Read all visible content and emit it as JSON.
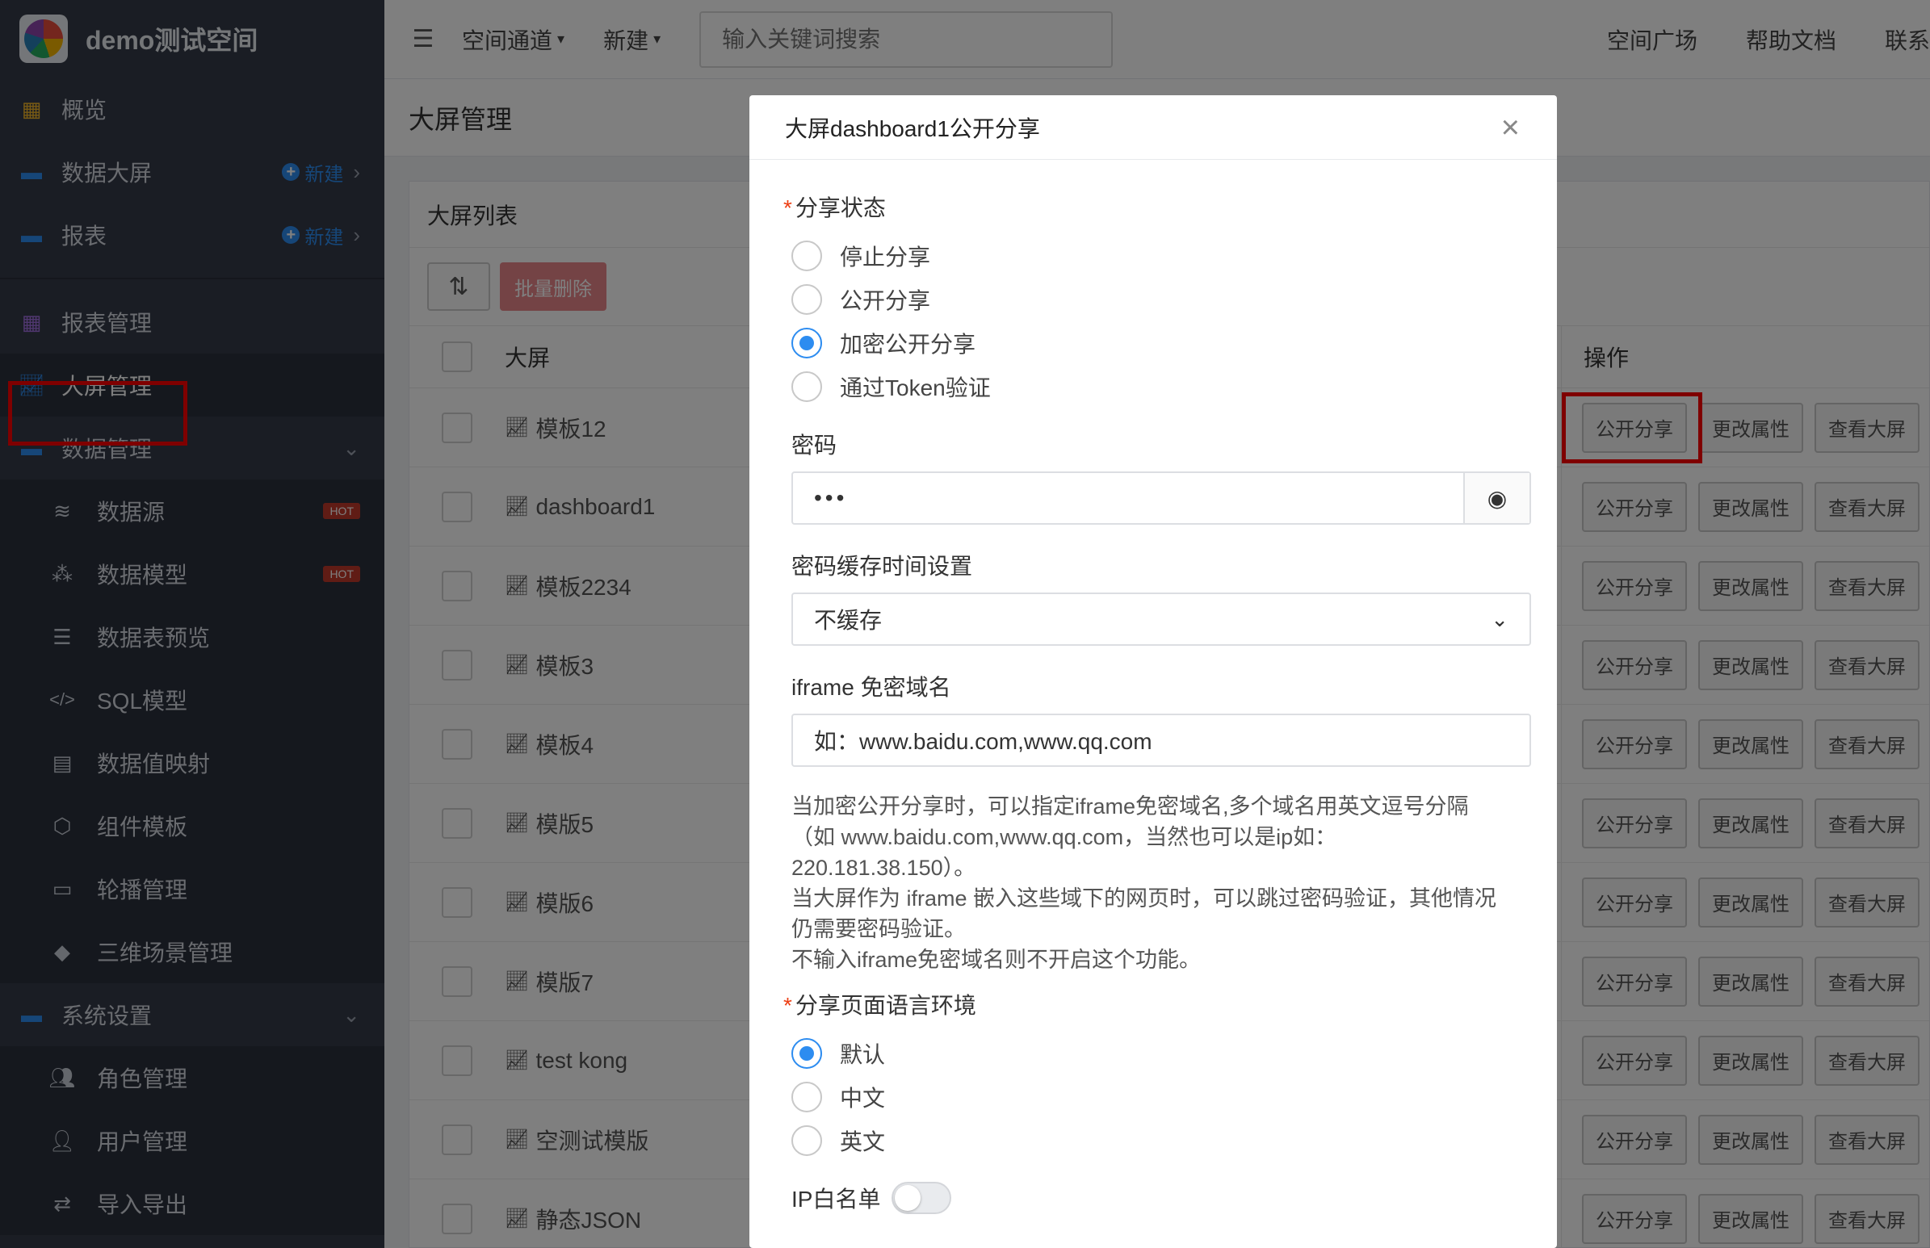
{
  "brand": {
    "name": "demo测试空间"
  },
  "sidebar": {
    "top_items": [
      {
        "label": "概览",
        "icon": "grid-icon"
      },
      {
        "label": "数据大屏",
        "icon": "folder-icon",
        "new_label": "新建"
      },
      {
        "label": "报表",
        "icon": "folder-icon",
        "new_label": "新建"
      }
    ],
    "mgmt_items": [
      {
        "label": "报表管理",
        "icon": "apps-icon"
      },
      {
        "label": "大屏管理",
        "icon": "chart-line-icon"
      },
      {
        "label": "数据管理",
        "icon": "folder-icon"
      }
    ],
    "data_sub": [
      {
        "label": "数据源",
        "icon": "database-icon",
        "badge": "HOT"
      },
      {
        "label": "数据模型",
        "icon": "cubes-icon",
        "badge": "HOT"
      },
      {
        "label": "数据表预览",
        "icon": "list-icon"
      },
      {
        "label": "SQL模型",
        "icon": "code-icon"
      },
      {
        "label": "数据值映射",
        "icon": "book-icon"
      },
      {
        "label": "组件模板",
        "icon": "cube-outline-icon"
      },
      {
        "label": "轮播管理",
        "icon": "monitor-icon"
      },
      {
        "label": "三维场景管理",
        "icon": "cube-icon"
      }
    ],
    "settings": {
      "label": "系统设置",
      "icon": "folder-icon"
    },
    "settings_sub": [
      {
        "label": "角色管理",
        "icon": "users-icon"
      },
      {
        "label": "用户管理",
        "icon": "user-icon"
      },
      {
        "label": "导入导出",
        "icon": "exchange-icon"
      }
    ]
  },
  "topbar": {
    "menu1": "空间通道",
    "menu2": "新建",
    "search_placeholder": "输入关键词搜索",
    "right1": "空间广场",
    "right2": "帮助文档",
    "right3": "联系"
  },
  "page": {
    "title": "大屏管理"
  },
  "panel": {
    "title": "大屏列表",
    "batch_delete": "批量删除",
    "col_name": "大屏",
    "col_ops": "操作",
    "op_share": "公开分享",
    "op_edit": "更改属性",
    "op_view": "查看大屏",
    "rows": [
      "模板12",
      "dashboard1",
      "模板2234",
      "模板3",
      "模板4",
      "模版5",
      "模版6",
      "模版7",
      "test kong",
      "空测试模版",
      "静态JSON"
    ]
  },
  "modal": {
    "title": "大屏dashboard1公开分享",
    "share_status_label": "分享状态",
    "share_options": [
      "停止分享",
      "公开分享",
      "加密公开分享",
      "通过Token验证"
    ],
    "share_selected_index": 2,
    "password_label": "密码",
    "password_value": "•••",
    "cache_label": "密码缓存时间设置",
    "cache_value": "不缓存",
    "iframe_label": "iframe 免密域名",
    "iframe_placeholder": "如：www.baidu.com,www.qq.com",
    "help_line1": "当加密公开分享时，可以指定iframe免密域名,多个域名用英文逗号分隔",
    "help_line2": "（如 www.baidu.com,www.qq.com，当然也可以是ip如：",
    "help_line3": "220.181.38.150）。",
    "help_line4": "当大屏作为 iframe 嵌入这些域下的网页时，可以跳过密码验证，其他情况",
    "help_line5": "仍需要密码验证。",
    "help_line6": "不输入iframe免密域名则不开启这个功能。",
    "lang_label": "分享页面语言环境",
    "lang_options": [
      "默认",
      "中文",
      "英文"
    ],
    "lang_selected_index": 0,
    "ip_whitelist_label": "IP白名单",
    "ip_whitelist_on": false
  },
  "colors": {
    "sidebar_bg": "#343a48",
    "accent": "#2d8cf0",
    "highlight": "#ff0000",
    "danger_soft": "#e9868a"
  }
}
